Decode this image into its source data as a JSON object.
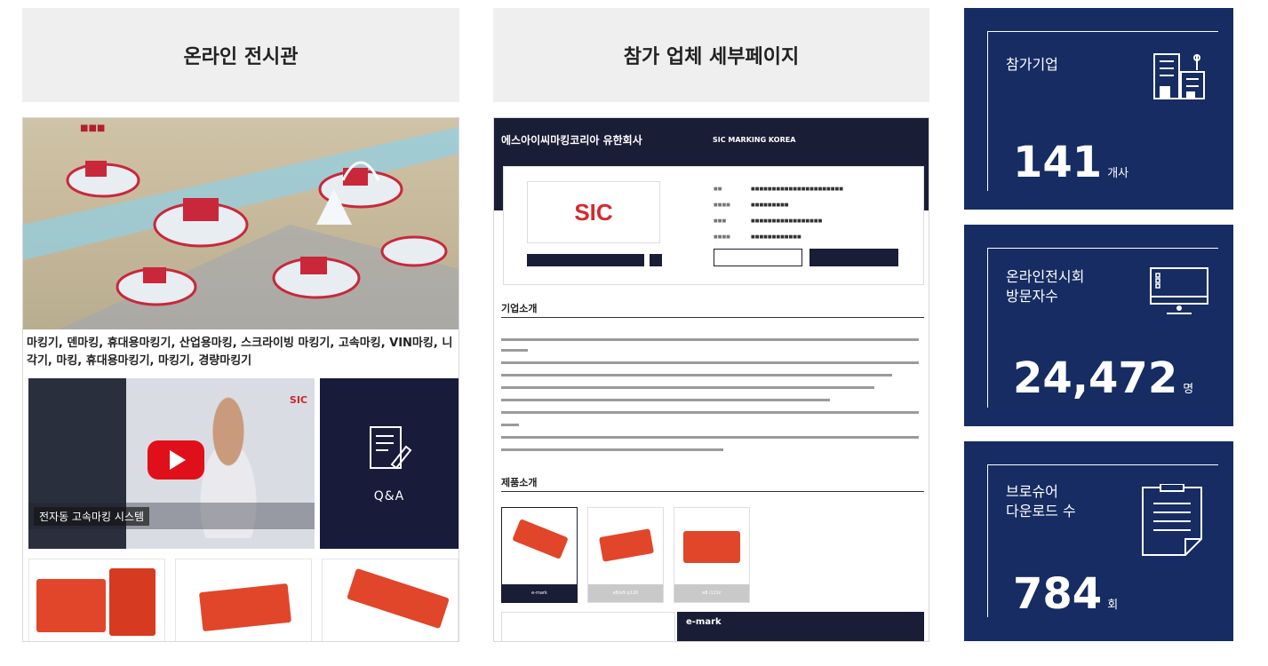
{
  "headers": {
    "online_hall": "온라인 전시관",
    "exhibitor_page": "참가 업체 세부페이지"
  },
  "online_hall": {
    "tagline": "마킹기, 덴마킹, 휴대용마킹기, 산업용마킹, 스크라이빙 마킹기, 고속마킹, VIN마킹, 니각기, 마킹, 휴대용마킹기, 마킹기, 경량마킹기",
    "video_caption": "전자동 고속마킹 시스템",
    "video_brand": "SIC",
    "qa_label": "Q&A",
    "colors": {
      "navy": "#181c3a",
      "play": "#e0101b",
      "machine": "#e1462a"
    }
  },
  "exhibitor": {
    "company_name_ko": "에스아이씨마킹코리아 유한회사",
    "company_name_en": "SIC MARKING KOREA",
    "logo_text": "SIC",
    "company_intro_title": "기업소개",
    "products_title": "제품소개",
    "products": [
      {
        "label": "e-mark"
      },
      {
        "label": "e8/e9 p120"
      },
      {
        "label": "e8 i122c"
      }
    ],
    "detail_title": "e-mark"
  },
  "stats": [
    {
      "label": "참가기업",
      "value": "141",
      "unit": "개사",
      "icon": "building-icon"
    },
    {
      "label": "온라인전시회\n방문자수",
      "value": "24,472",
      "unit": "명",
      "icon": "monitor-icon"
    },
    {
      "label": "브로슈어\n다운로드 수",
      "value": "784",
      "unit": "회",
      "icon": "document-icon"
    }
  ],
  "colors": {
    "stat_bg": "#162c62",
    "header_bg": "#efefef"
  }
}
